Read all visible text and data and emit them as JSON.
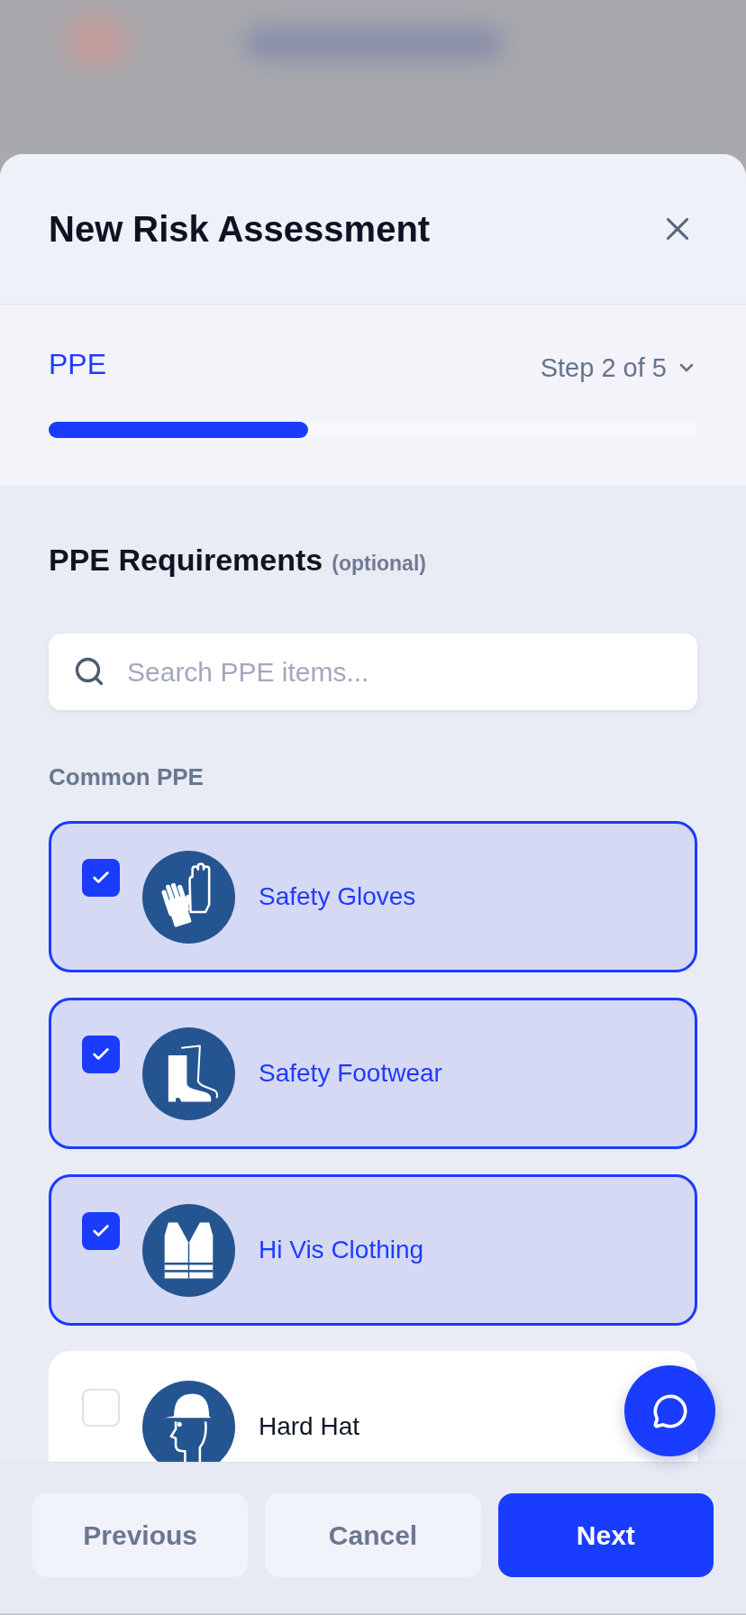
{
  "dialog": {
    "title": "New Risk Assessment"
  },
  "progress": {
    "step_name": "PPE",
    "step_label": "Step 2 of 5",
    "level": 0.4
  },
  "section": {
    "title": "PPE Requirements",
    "note": "(optional)"
  },
  "search": {
    "placeholder": "Search PPE items..."
  },
  "group_label": "Common PPE",
  "items": [
    {
      "label": "Safety Gloves",
      "checked": true
    },
    {
      "label": "Safety Footwear",
      "checked": true
    },
    {
      "label": "Hi Vis Clothing",
      "checked": true
    },
    {
      "label": "Hard Hat",
      "checked": false
    }
  ],
  "footer": {
    "buttons": [
      {
        "label": "Previous",
        "kind": "secondary"
      },
      {
        "label": "Cancel",
        "kind": "secondary"
      },
      {
        "label": "Next",
        "kind": "primary"
      }
    ]
  }
}
